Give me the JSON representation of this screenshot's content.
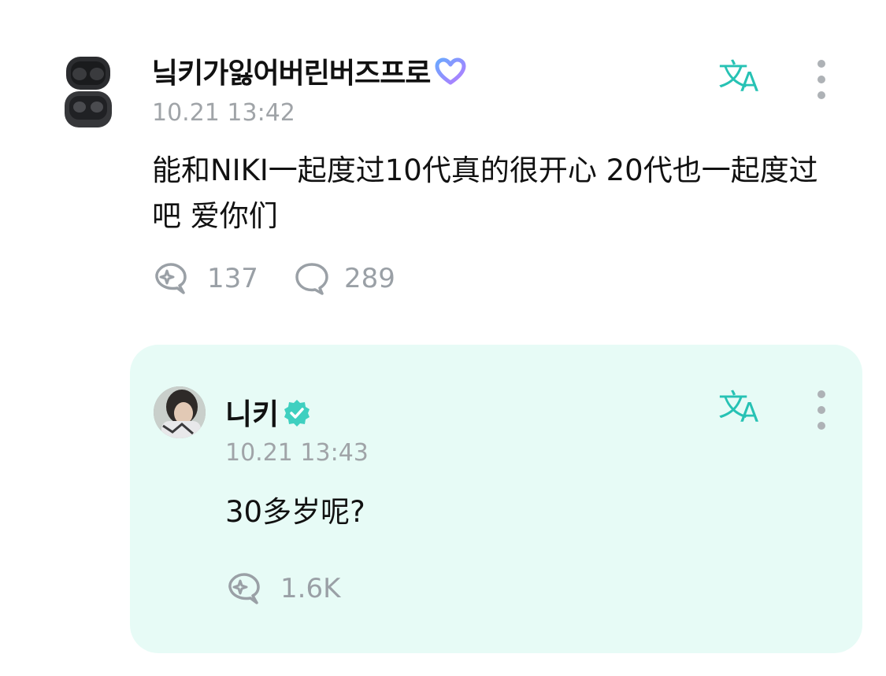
{
  "post": {
    "username": "닠키가잃어버린버즈프로",
    "time": "10.21 13:42",
    "text": "能和NIKI一起度过10代真的很开心 20代也一起度过吧 爱你们",
    "likes": "137",
    "comments": "289",
    "avatar_icon": "earbuds-case-icon",
    "badge_icon": "heart-badge-icon"
  },
  "reply": {
    "username": "니키",
    "time": "10.21 13:43",
    "text": "30多岁呢?",
    "likes": "1.6K",
    "badge_icon": "verified-badge-icon"
  },
  "icons": {
    "translate": "translate-icon",
    "more": "more-vertical-icon",
    "like": "sparkle-like-icon",
    "comment": "comment-bubble-icon"
  },
  "colors": {
    "accent": "#27c2b4",
    "reply_bg": "#e7fbf6",
    "muted": "#9aa0a6",
    "verified": "#3fd0c0"
  }
}
